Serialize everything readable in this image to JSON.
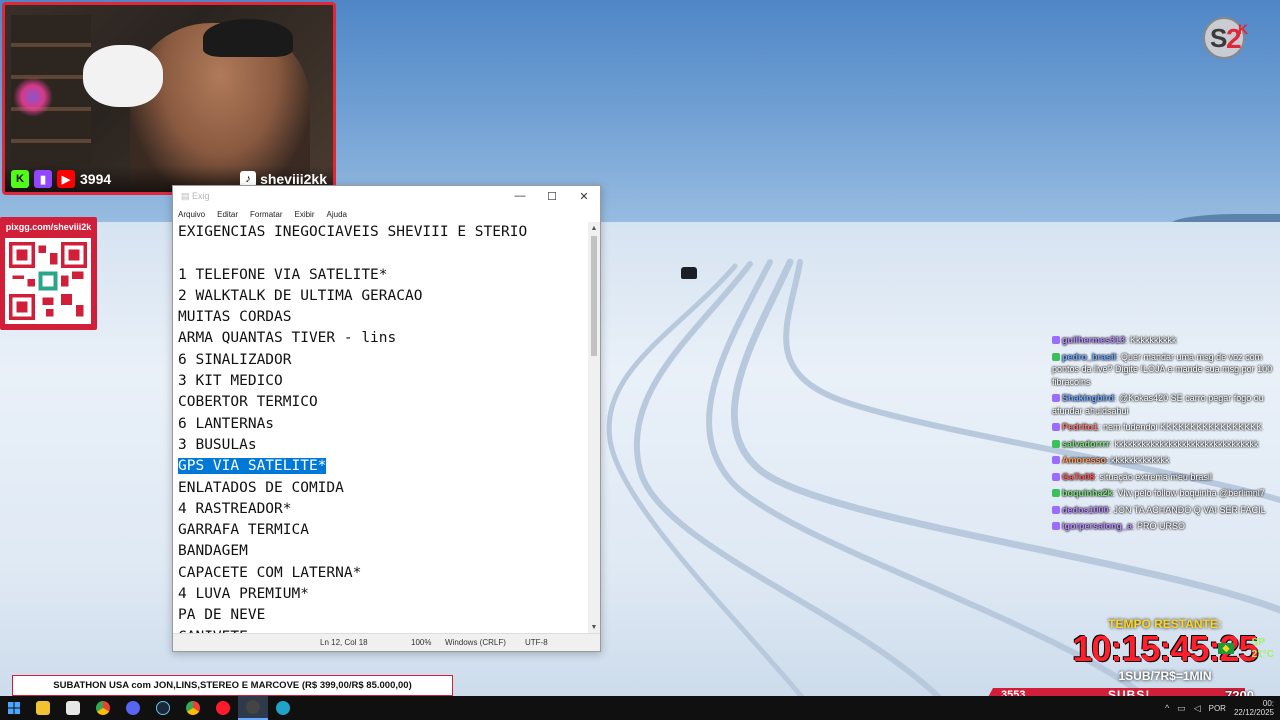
{
  "webcam": {
    "viewer_count": "3994",
    "handle": "sheviii2kk",
    "platform_icons": [
      "kick-icon",
      "twitch-icon",
      "youtube-icon"
    ]
  },
  "qr": {
    "url": "pixgg.com/sheviii2k"
  },
  "notepad": {
    "menu": [
      "Arquivo",
      "Editar",
      "Formatar",
      "Exibir",
      "Ajuda"
    ],
    "lines": [
      "EXIGENCIAS INEGOCIAVEIS SHEVIII E STERIO",
      "",
      "1 TELEFONE VIA SATELITE*",
      "2 WALKTALK DE ULTIMA GERACAO",
      "MUITAS CORDAS",
      "ARMA QUANTAS TIVER - lins",
      "6 SINALIZADOR",
      "3 KIT MEDICO",
      "COBERTOR TERMICO",
      "6 LANTERNAs",
      "3 BUSULAs",
      "GPS VIA SATELITE*",
      "ENLATADOS DE COMIDA",
      "4 RASTREADOR*",
      "GARRAFA TERMICA",
      "BANDAGEM",
      "CAPACETE COM LATERNA*",
      "4 LUVA PREMIUM*",
      "PA DE NEVE",
      "CANIVETE"
    ],
    "selected_line_index": 11,
    "status": {
      "position": "Ln 12, Col 18",
      "zoom": "100%",
      "line_ending": "Windows (CRLF)",
      "encoding": "UTF-8"
    }
  },
  "chat": [
    {
      "user": "guilhermes313",
      "text": ": Kkkkkkkkkk"
    },
    {
      "user": "pedro_brasil",
      "text": ": Quer mandar uma msg de voz com pontos da live? Digite !LOJA e mande sua msg por 100 fibracoins"
    },
    {
      "user": "Shakingbird",
      "text": ": @Kokas420 SE carro pegar fogo ou afundar ahuidsahui"
    },
    {
      "user": "Pedrito1",
      "text": ": nem fudendoi KKKKKKKKKKKKKKKKK"
    },
    {
      "user": "salvadorrrr",
      "text": ": kkkkkkkkkkkkkkkkkkkkkkkkkkkkkkkk"
    },
    {
      "user": "Amoresso",
      "text": ": kkkkkkkkkkkkk"
    },
    {
      "user": "GaTo08",
      "text": ": situação extrema meu brasil"
    },
    {
      "user": "boquinha2k",
      "text": ": Vlw pelo follow boquinha @berlimnl7"
    },
    {
      "user": "dedos1000",
      "text": ": JON TA ACHANDO Q VAI SER FACIL"
    },
    {
      "user": "igorpersalong_a",
      "text": ": PRO URSO"
    }
  ],
  "timer": {
    "label": "TEMPO RESTANTE:",
    "time": "10:15:45:25",
    "side_top": "SP",
    "side_bottom": "21°C",
    "rate": "1SUB/7R$=1MIN"
  },
  "banner": {
    "text": "SUBATHON USA com JON,LINS,STEREO E MARCOVE (R$ 399,00/R$ 85.000,00)"
  },
  "statbar": {
    "left_count": "3553",
    "subs_label": "SUBS!",
    "total": "7200"
  },
  "taskbar": {
    "apps": [
      "file-explorer-icon",
      "store-icon",
      "chrome-icon",
      "discord-icon",
      "steam-icon",
      "chrome-alt-icon",
      "opera-icon",
      "obs-icon",
      "edge-icon"
    ],
    "language": "POR",
    "date": "22/12/2025",
    "time": "00:"
  },
  "colors": {
    "accent_red": "#d11f3a",
    "timer_red": "#ff1f2d",
    "timer_gold": "#ffd51a",
    "selection": "#0078d7"
  }
}
